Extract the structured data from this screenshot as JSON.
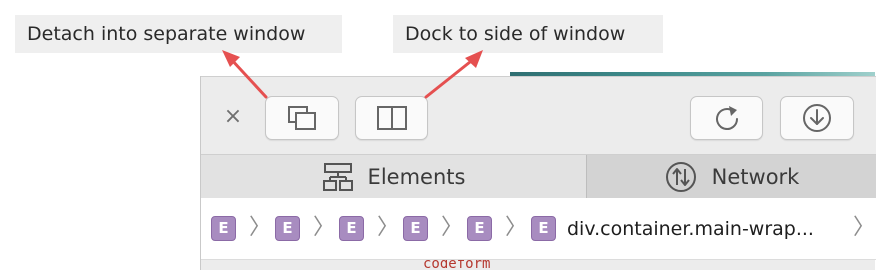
{
  "callouts": {
    "detach": "Detach into separate window",
    "dock": "Dock to side of window"
  },
  "colors": {
    "arrow": "#e55050",
    "crumb_badge": "#a88cc0",
    "page_accent": "#3d8a8a"
  },
  "toolbar": {
    "close_glyph": "×",
    "buttons": [
      {
        "name": "detach-window-button",
        "icon": "detach-window-icon"
      },
      {
        "name": "dock-side-button",
        "icon": "dock-side-icon"
      },
      {
        "name": "reload-button",
        "icon": "reload-icon"
      },
      {
        "name": "download-button",
        "icon": "download-icon"
      }
    ]
  },
  "tabs": [
    {
      "label": "Elements",
      "icon": "elements-icon",
      "active": false
    },
    {
      "label": "Network",
      "icon": "network-icon",
      "active": true
    }
  ],
  "breadcrumbs": {
    "badges": [
      "E",
      "E",
      "E",
      "E",
      "E",
      "E"
    ],
    "separator": "〉",
    "last_label": "div.container.main-wrap...",
    "trailing_chevron": "〉"
  },
  "cut_off_text": "codeform"
}
